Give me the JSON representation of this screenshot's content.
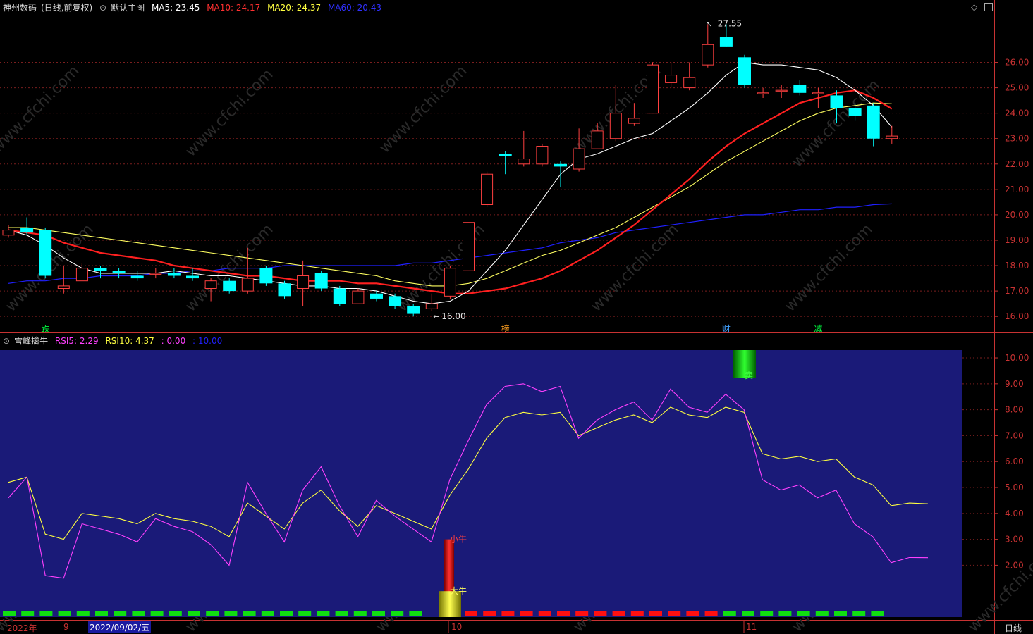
{
  "main_header": {
    "stock": "神州数码",
    "mode": "(日线,前复权)",
    "template": "默认主图",
    "ma5": "MA5: 23.45",
    "ma10": "MA10: 24.17",
    "ma20": "MA20: 24.37",
    "ma60": "MA60: 20.43"
  },
  "sub_header": {
    "name": "雪峰擒牛",
    "rsi5": "RSI5: 2.29",
    "rsi10": "RSI10: 4.37",
    "v1": ": 0.00",
    "v2": ": 10.00"
  },
  "price_axis": [
    "26.00",
    "25.00",
    "24.00",
    "23.00",
    "22.00",
    "21.00",
    "20.00",
    "19.00",
    "18.00",
    "17.00",
    "16.00"
  ],
  "ind_axis": [
    "10.00",
    "9.00",
    "8.00",
    "7.00",
    "6.00",
    "5.00",
    "4.00",
    "3.00",
    "2.00"
  ],
  "annotations": {
    "high": "27.55",
    "low": "16.00",
    "markers": [
      "跌",
      "榜",
      "财",
      "减"
    ],
    "bull_small": "小牛",
    "bull_big": "大牛",
    "sell": "卖"
  },
  "time_axis": {
    "year": "2022年",
    "m9": "9",
    "cursor": "2022/09/02/五",
    "m10": "10",
    "m11": "11",
    "period": "日线"
  },
  "watermark": "www.cfchi.com",
  "colors": {
    "up": "#ff4040",
    "down": "#00ffff",
    "ma5": "#ffffff",
    "ma10": "#ff2020",
    "ma20": "#ffff60",
    "ma60": "#2020ff",
    "rsi5": "#ff40ff",
    "rsi10": "#ffff40",
    "panel": "#1a1a78"
  },
  "chart_data": [
    {
      "type": "candlestick",
      "title": "神州数码 (日线,前复权)",
      "ylim": [
        15.7,
        27.9
      ],
      "high_label": 27.55,
      "low_label": 16.0,
      "candles": [
        {
          "o": 19.2,
          "c": 19.4,
          "h": 19.6,
          "l": 19.1
        },
        {
          "o": 19.5,
          "c": 19.3,
          "h": 19.9,
          "l": 19.2
        },
        {
          "o": 19.4,
          "c": 17.6,
          "h": 19.5,
          "l": 17.5
        },
        {
          "o": 17.1,
          "c": 17.2,
          "h": 18.0,
          "l": 16.9
        },
        {
          "o": 17.4,
          "c": 17.9,
          "h": 18.1,
          "l": 17.4
        },
        {
          "o": 17.9,
          "c": 17.8,
          "h": 18.0,
          "l": 17.5
        },
        {
          "o": 17.8,
          "c": 17.7,
          "h": 17.9,
          "l": 17.5
        },
        {
          "o": 17.6,
          "c": 17.5,
          "h": 17.8,
          "l": 17.4
        },
        {
          "o": 17.7,
          "c": 17.7,
          "h": 17.9,
          "l": 17.5
        },
        {
          "o": 17.7,
          "c": 17.6,
          "h": 17.9,
          "l": 17.5
        },
        {
          "o": 17.6,
          "c": 17.5,
          "h": 17.9,
          "l": 17.4
        },
        {
          "o": 17.1,
          "c": 17.4,
          "h": 17.5,
          "l": 16.6
        },
        {
          "o": 17.4,
          "c": 17.0,
          "h": 17.5,
          "l": 16.9
        },
        {
          "o": 17.0,
          "c": 17.5,
          "h": 18.7,
          "l": 16.9
        },
        {
          "o": 17.9,
          "c": 17.3,
          "h": 18.0,
          "l": 17.2
        },
        {
          "o": 17.3,
          "c": 16.8,
          "h": 17.4,
          "l": 16.7
        },
        {
          "o": 17.1,
          "c": 17.6,
          "h": 18.2,
          "l": 16.4
        },
        {
          "o": 17.7,
          "c": 17.1,
          "h": 17.8,
          "l": 17.0
        },
        {
          "o": 17.1,
          "c": 16.5,
          "h": 17.2,
          "l": 16.4
        },
        {
          "o": 16.5,
          "c": 17.0,
          "h": 17.1,
          "l": 16.5
        },
        {
          "o": 16.9,
          "c": 16.7,
          "h": 17.0,
          "l": 16.6
        },
        {
          "o": 16.8,
          "c": 16.4,
          "h": 16.9,
          "l": 16.3
        },
        {
          "o": 16.4,
          "c": 16.1,
          "h": 16.5,
          "l": 16.0
        },
        {
          "o": 16.3,
          "c": 16.5,
          "h": 16.9,
          "l": 16.2
        },
        {
          "o": 16.8,
          "c": 17.9,
          "h": 18.0,
          "l": 16.7
        },
        {
          "o": 17.8,
          "c": 19.7,
          "h": 19.7,
          "l": 17.8
        },
        {
          "o": 20.4,
          "c": 21.6,
          "h": 21.7,
          "l": 20.3
        },
        {
          "o": 22.4,
          "c": 22.3,
          "h": 22.5,
          "l": 21.6
        },
        {
          "o": 22.0,
          "c": 22.2,
          "h": 23.3,
          "l": 21.9
        },
        {
          "o": 22.0,
          "c": 22.7,
          "h": 22.8,
          "l": 21.9
        },
        {
          "o": 22.0,
          "c": 21.9,
          "h": 22.1,
          "l": 21.1
        },
        {
          "o": 21.8,
          "c": 22.6,
          "h": 23.4,
          "l": 21.7
        },
        {
          "o": 22.6,
          "c": 23.3,
          "h": 23.6,
          "l": 22.6
        },
        {
          "o": 23.0,
          "c": 24.0,
          "h": 25.1,
          "l": 22.9
        },
        {
          "o": 23.6,
          "c": 23.8,
          "h": 24.4,
          "l": 23.5
        },
        {
          "o": 24.0,
          "c": 25.9,
          "h": 26.0,
          "l": 24.0
        },
        {
          "o": 25.2,
          "c": 25.5,
          "h": 26.0,
          "l": 25.0
        },
        {
          "o": 25.0,
          "c": 25.4,
          "h": 26.0,
          "l": 24.9
        },
        {
          "o": 25.9,
          "c": 26.7,
          "h": 27.5,
          "l": 25.8
        },
        {
          "o": 27.0,
          "c": 26.6,
          "h": 27.5,
          "l": 26.6
        },
        {
          "o": 26.2,
          "c": 25.1,
          "h": 26.3,
          "l": 25.0
        },
        {
          "o": 24.8,
          "c": 24.8,
          "h": 25.0,
          "l": 24.6
        },
        {
          "o": 24.9,
          "c": 24.9,
          "h": 25.1,
          "l": 24.6
        },
        {
          "o": 25.1,
          "c": 24.8,
          "h": 25.3,
          "l": 24.7
        },
        {
          "o": 24.8,
          "c": 24.8,
          "h": 25.0,
          "l": 24.2
        },
        {
          "o": 24.7,
          "c": 24.2,
          "h": 24.9,
          "l": 23.6
        },
        {
          "o": 24.2,
          "c": 23.9,
          "h": 24.4,
          "l": 23.7
        },
        {
          "o": 24.3,
          "c": 23.0,
          "h": 24.4,
          "l": 22.7
        },
        {
          "o": 23.0,
          "c": 23.1,
          "h": 23.5,
          "l": 22.8
        }
      ],
      "ma5": [
        19.4,
        19.2,
        18.8,
        18.3,
        17.9,
        17.7,
        17.7,
        17.7,
        17.7,
        17.8,
        17.7,
        17.6,
        17.6,
        17.5,
        17.4,
        17.3,
        17.2,
        17.2,
        17.1,
        17.1,
        17.0,
        16.8,
        16.6,
        16.5,
        16.6,
        17.0,
        17.8,
        18.6,
        19.6,
        20.6,
        21.6,
        22.2,
        22.4,
        22.7,
        23.0,
        23.2,
        23.7,
        24.2,
        24.8,
        25.5,
        26.0,
        25.9,
        25.9,
        25.8,
        25.7,
        25.4,
        24.9,
        24.3,
        23.45
      ],
      "ma10": [
        19.4,
        19.3,
        19.2,
        18.9,
        18.7,
        18.5,
        18.4,
        18.3,
        18.2,
        18.0,
        17.9,
        17.8,
        17.7,
        17.6,
        17.6,
        17.5,
        17.4,
        17.4,
        17.4,
        17.3,
        17.3,
        17.2,
        17.1,
        17.0,
        16.9,
        16.9,
        17.0,
        17.1,
        17.3,
        17.5,
        17.8,
        18.2,
        18.6,
        19.1,
        19.6,
        20.2,
        20.8,
        21.4,
        22.1,
        22.7,
        23.2,
        23.6,
        24.0,
        24.4,
        24.6,
        24.8,
        24.9,
        24.6,
        24.17
      ],
      "ma20": [
        19.5,
        19.5,
        19.4,
        19.3,
        19.2,
        19.1,
        19.0,
        18.9,
        18.8,
        18.7,
        18.6,
        18.5,
        18.4,
        18.3,
        18.2,
        18.1,
        18.0,
        17.9,
        17.8,
        17.7,
        17.6,
        17.4,
        17.3,
        17.2,
        17.2,
        17.3,
        17.5,
        17.8,
        18.1,
        18.4,
        18.6,
        18.9,
        19.2,
        19.5,
        19.9,
        20.3,
        20.7,
        21.1,
        21.6,
        22.1,
        22.5,
        22.9,
        23.3,
        23.7,
        24.0,
        24.2,
        24.3,
        24.4,
        24.37
      ],
      "ma60": [
        17.3,
        17.4,
        17.4,
        17.5,
        17.5,
        17.6,
        17.6,
        17.6,
        17.7,
        17.7,
        17.8,
        17.8,
        17.9,
        17.9,
        17.9,
        18.0,
        18.0,
        18.0,
        18.0,
        18.0,
        18.0,
        18.0,
        18.1,
        18.1,
        18.2,
        18.3,
        18.4,
        18.5,
        18.6,
        18.7,
        18.9,
        19.0,
        19.1,
        19.3,
        19.4,
        19.5,
        19.6,
        19.7,
        19.8,
        19.9,
        20.0,
        20.0,
        20.1,
        20.2,
        20.2,
        20.3,
        20.3,
        20.4,
        20.43
      ]
    },
    {
      "type": "line",
      "title": "雪峰擒牛",
      "ylim": [
        0,
        10.3
      ],
      "series": [
        {
          "name": "RSI5",
          "values": [
            4.6,
            5.4,
            1.6,
            1.5,
            3.6,
            3.4,
            3.2,
            2.9,
            3.8,
            3.5,
            3.3,
            2.8,
            2.0,
            5.2,
            4.0,
            2.9,
            4.9,
            5.8,
            4.3,
            3.1,
            4.5,
            3.9,
            3.4,
            2.9,
            5.3,
            6.8,
            8.2,
            8.9,
            9.0,
            8.7,
            8.9,
            6.9,
            7.6,
            8.0,
            8.3,
            7.6,
            8.8,
            8.1,
            7.9,
            8.6,
            8.0,
            5.3,
            4.9,
            5.1,
            4.6,
            4.9,
            3.6,
            3.1,
            2.1,
            2.3,
            2.29
          ]
        },
        {
          "name": "RSI10",
          "values": [
            5.2,
            5.4,
            3.2,
            3.0,
            4.0,
            3.9,
            3.8,
            3.6,
            4.0,
            3.8,
            3.7,
            3.5,
            3.1,
            4.4,
            3.9,
            3.4,
            4.4,
            4.9,
            4.1,
            3.5,
            4.3,
            4.0,
            3.7,
            3.4,
            4.7,
            5.7,
            6.9,
            7.7,
            7.9,
            7.8,
            7.9,
            7.0,
            7.3,
            7.6,
            7.8,
            7.5,
            8.1,
            7.8,
            7.7,
            8.1,
            7.9,
            6.3,
            6.1,
            6.2,
            6.0,
            6.1,
            5.4,
            5.1,
            4.3,
            4.4,
            4.37
          ]
        }
      ],
      "signals": {
        "小牛": 3.0,
        "大牛": 1.0,
        "卖": 10.0
      }
    }
  ]
}
